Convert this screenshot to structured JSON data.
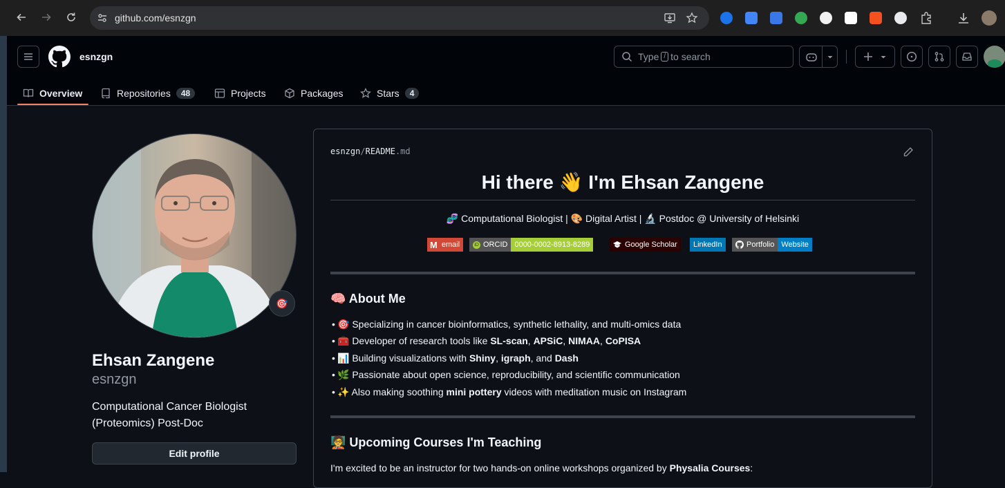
{
  "browser": {
    "url": "github.com/esnzgn"
  },
  "header": {
    "username": "esnzgn",
    "search_placeholder_prefix": "Type",
    "search_key": "/",
    "search_placeholder_suffix": "to search"
  },
  "tabs": [
    {
      "label": "Overview",
      "count": null,
      "selected": true
    },
    {
      "label": "Repositories",
      "count": "48"
    },
    {
      "label": "Projects",
      "count": null
    },
    {
      "label": "Packages",
      "count": null
    },
    {
      "label": "Stars",
      "count": "4"
    }
  ],
  "profile": {
    "full_name": "Ehsan Zangene",
    "login": "esnzgn",
    "bio": "Computational Cancer Biologist (Proteomics) Post-Doc",
    "status_emoji": "🎯",
    "edit_button": "Edit profile"
  },
  "readme": {
    "path_user": "esnzgn",
    "path_sep": "/",
    "path_file": "README",
    "path_ext": ".md",
    "heading": "Hi there 👋 I'm Ehsan Zangene",
    "tagline": "🧬 Computational Biologist | 🎨 Digital Artist | 🔬 Postdoc @ University of Helsinki",
    "badges": {
      "email": "email",
      "orcid_label": "ORCID",
      "orcid_value": "0000-0002-8913-8289",
      "scholar": "Google Scholar",
      "linkedin": "LinkedIn",
      "portfolio_label": "Portfolio",
      "portfolio_value": "Website"
    },
    "about_heading": "🧠 About Me",
    "about_items": [
      {
        "pre": "🎯 Specializing in cancer bioinformatics, synthetic lethality, and multi-omics data"
      },
      {
        "pre": "🧰 Developer of research tools like ",
        "b1": "SL-scan",
        "s1": ", ",
        "b2": "APSiC",
        "s2": ", ",
        "b3": "NIMAA",
        "s3": ", ",
        "b4": "CoPISA"
      },
      {
        "pre": "📊 Building visualizations with ",
        "b1": "Shiny",
        "s1": ", ",
        "b2": "igraph",
        "s2": ", and ",
        "b3": "Dash"
      },
      {
        "pre": "🌿 Passionate about open science, reproducibility, and scientific communication"
      },
      {
        "pre": "✨ Also making soothing ",
        "b1": "mini pottery",
        "s1": " videos with meditation music on Instagram"
      }
    ],
    "courses_heading": "🧑‍🏫 Upcoming Courses I'm Teaching",
    "courses_intro_pre": "I'm excited to be an instructor for two hands-on online workshops organized by ",
    "courses_intro_bold": "Physalia Courses",
    "courses_intro_post": ":"
  },
  "colors": {
    "bg": "#0d1117",
    "header_bg": "#010409",
    "accent_underline": "#f78166",
    "email_badge": "#d14836",
    "orcid_badge": "#a6ce39",
    "linkedin_badge": "#0077b5",
    "website_badge": "#007ec6"
  }
}
